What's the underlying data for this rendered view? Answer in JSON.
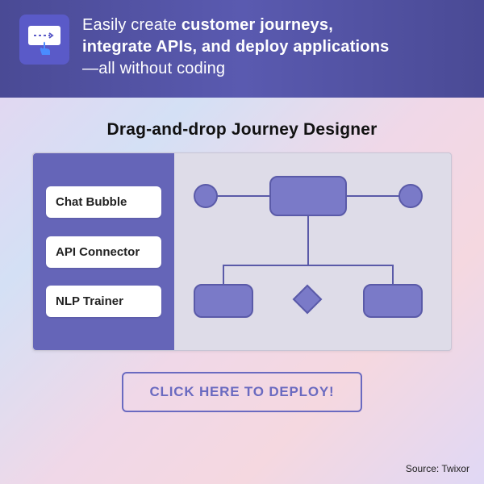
{
  "header": {
    "line1_plain": "Easily create ",
    "line1_bold": "customer journeys,",
    "line2_bold": "integrate APIs, and deploy applications",
    "line3_plain": "—all without coding"
  },
  "designer": {
    "title": "Drag-and-drop Journey Designer",
    "palette": {
      "item1": "Chat Bubble",
      "item2": "API Connector",
      "item3": "NLP Trainer"
    }
  },
  "deploy": {
    "label": "CLICK HERE TO DEPLOY!"
  },
  "source": {
    "label": "Source: Twixor"
  },
  "colors": {
    "accent": "#6a6ac0",
    "header_bg": "#4a4a95",
    "node_fill": "#7a7ac8",
    "node_border": "#5a5aa8",
    "palette_bg": "#6565b8"
  }
}
